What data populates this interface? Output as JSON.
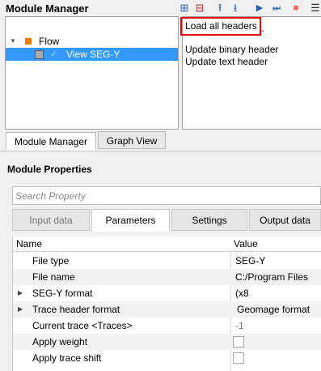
{
  "module_manager": {
    "title": "Module Manager",
    "toolbar": [
      {
        "icon": "add-module-icon",
        "glyph": "⊞",
        "color": "#1a5fb4"
      },
      {
        "icon": "remove-module-icon",
        "glyph": "⊟",
        "color": "#c01c28"
      },
      {
        "icon": "move-up-icon",
        "glyph": "⭱",
        "color": "#1a5fb4"
      },
      {
        "icon": "move-down-icon",
        "glyph": "⭳",
        "color": "#1a5fb4"
      },
      {
        "icon": "run-icon",
        "glyph": "▶",
        "color": "#1a5fb4"
      },
      {
        "icon": "run-step-icon",
        "glyph": "⏭",
        "color": "#1a5fb4"
      },
      {
        "icon": "stop-icon",
        "glyph": "■",
        "color": "#f66151"
      },
      {
        "icon": "list-icon",
        "glyph": "☰",
        "color": "#333333"
      }
    ],
    "tree": {
      "root_label": "Flow",
      "child_label": "View SEG-Y"
    },
    "context_menu": {
      "items": [
        "Load all headers",
        "Update binary header",
        "Update text header"
      ],
      "separator": "-"
    },
    "tabs": [
      "Module Manager",
      "Graph View"
    ]
  },
  "module_properties": {
    "title": "Module Properties",
    "search_placeholder": "Search Property",
    "tabs": [
      "Input data",
      "Parameters",
      "Settings",
      "Output data"
    ],
    "columns": {
      "name": "Name",
      "value": "Value"
    },
    "rows": [
      {
        "name": "File type",
        "value": "SEG-Y"
      },
      {
        "name": "File name",
        "value": "C:/Program Files (x8"
      },
      {
        "name": "SEG-Y format",
        "value": ""
      },
      {
        "name": "Trace header format",
        "value": "Geomage format"
      },
      {
        "name": "Current trace <Traces>",
        "value": "-1"
      },
      {
        "name": "Apply weight",
        "value": ""
      },
      {
        "name": "Apply trace shift",
        "value": ""
      }
    ]
  },
  "colors": {
    "selection": "#3399ff",
    "highlight_box": "#e00000",
    "flow_icon": "#f57900"
  }
}
